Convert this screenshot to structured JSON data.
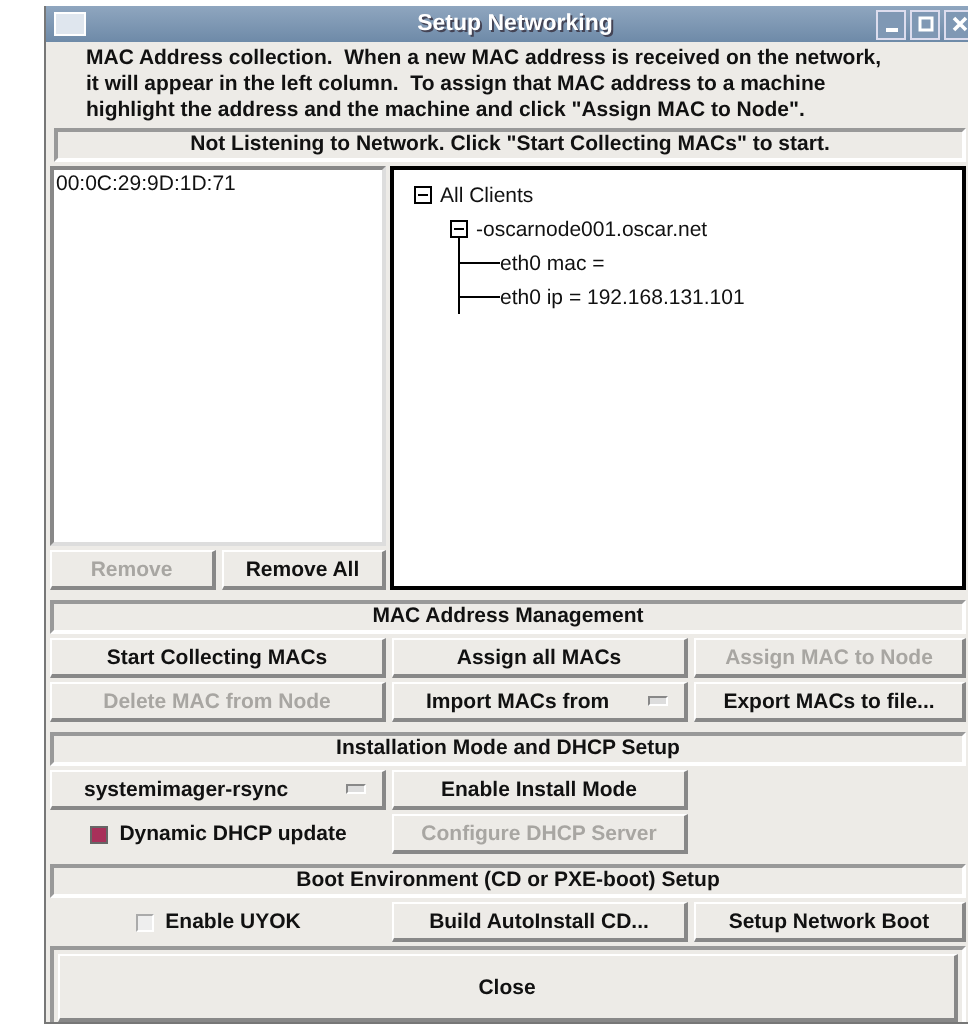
{
  "window": {
    "title": "Setup Networking"
  },
  "description": "MAC Address collection.  When a new MAC address is received on the network, it will appear in the left column.  To assign that MAC address to a machine highlight the address and the machine and click \"Assign MAC to Node\".",
  "status": "Not Listening to Network. Click \"Start Collecting MACs\" to start.",
  "mac_list": [
    "00:0C:29:9D:1D:71"
  ],
  "list_buttons": [
    {
      "label": "Remove",
      "disabled": true
    },
    {
      "label": "Remove All",
      "disabled": false
    }
  ],
  "tree": [
    {
      "label": "All Clients",
      "expanded": true,
      "children": [
        {
          "label": "-oscarnode001.oscar.net",
          "expanded": true,
          "children": [
            {
              "label": "eth0 mac ="
            },
            {
              "label": "eth0 ip = 192.168.131.101"
            }
          ]
        }
      ]
    }
  ],
  "sections": [
    {
      "title": "MAC Address Management",
      "rows": [
        [
          {
            "kind": "button",
            "label": "Start Collecting MACs",
            "disabled": false
          },
          {
            "kind": "button",
            "label": "Assign all MACs",
            "disabled": false
          },
          {
            "kind": "button",
            "label": "Assign MAC to Node",
            "disabled": true
          }
        ],
        [
          {
            "kind": "button",
            "label": "Delete MAC from Node",
            "disabled": true
          },
          {
            "kind": "dropdown",
            "label": "Import MACs from",
            "disabled": false
          },
          {
            "kind": "button",
            "label": "Export MACs to file...",
            "disabled": false
          }
        ]
      ]
    },
    {
      "title": "Installation Mode and DHCP Setup",
      "rows": [
        [
          {
            "kind": "dropdown",
            "label": "systemimager-rsync",
            "disabled": false
          },
          {
            "kind": "button",
            "label": "Enable Install Mode",
            "disabled": false
          }
        ],
        [
          {
            "kind": "checkbox",
            "label": "Dynamic DHCP update",
            "checked": true
          },
          {
            "kind": "button",
            "label": "Configure DHCP Server",
            "disabled": true
          }
        ]
      ]
    },
    {
      "title": "Boot Environment (CD or PXE-boot) Setup",
      "rows": [
        [
          {
            "kind": "checkbox",
            "label": "Enable UYOK",
            "checked": false
          },
          {
            "kind": "button",
            "label": "Build AutoInstall CD...",
            "disabled": false
          },
          {
            "kind": "button",
            "label": "Setup Network Boot",
            "disabled": false
          }
        ]
      ]
    }
  ],
  "close_button": "Close"
}
